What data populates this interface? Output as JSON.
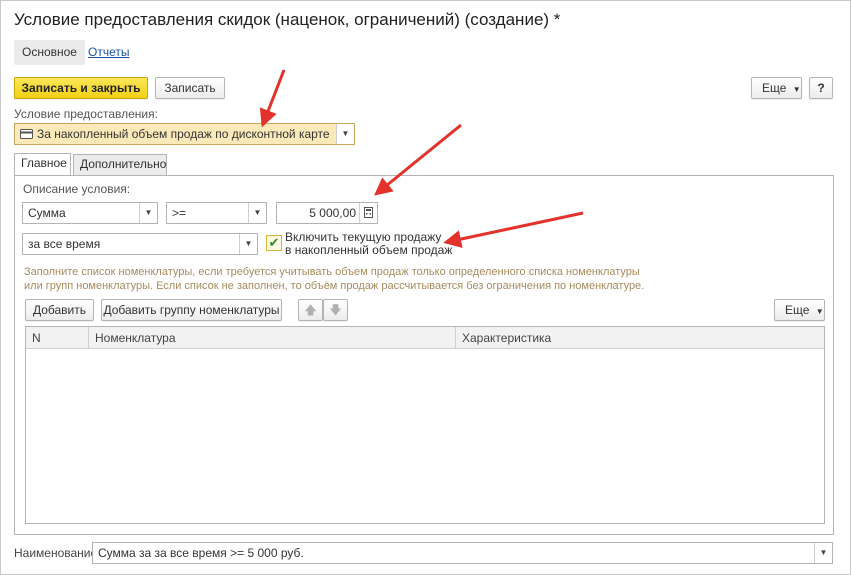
{
  "window": {
    "title": "Условие предоставления скидок (наценок, ограничений) (создание) *"
  },
  "nav": {
    "main": "Основное",
    "reports": "Отчеты"
  },
  "toolbar": {
    "save_close": "Записать и закрыть",
    "save": "Записать",
    "more": "Еще",
    "help": "?"
  },
  "condition": {
    "label": "Условие предоставления:",
    "value": "За накопленный объем продаж по дисконтной карте"
  },
  "tabs": {
    "main": "Главное",
    "extra": "Дополнительно"
  },
  "description": {
    "label": "Описание условия:",
    "type_value": "Сумма",
    "operator_value": ">=",
    "amount_value": "5 000,00",
    "period_value": "за все время",
    "include_current_line1": "Включить текущую продажу",
    "include_current_line2": "в накопленный объем продаж",
    "include_current_checked": true
  },
  "hint": {
    "line1": "Заполните список номенклатуры, если требуется учитывать объем продаж только определенного списка номенклатуры",
    "line2": "или групп номенклатуры. Если список не заполнен, то объём продаж рассчитывается без ограничения по номенклатуре."
  },
  "list_toolbar": {
    "add": "Добавить",
    "add_group": "Добавить группу номенклатуры",
    "more": "Еще"
  },
  "table": {
    "columns": [
      "N",
      "Номенклатура",
      "Характеристика"
    ],
    "rows": []
  },
  "footer": {
    "name_label": "Наименование:",
    "name_value": "Сумма за за все время  >= 5 000 руб."
  },
  "colors": {
    "primary_button": "#f5d728",
    "annotation_arrow": "#e3322b",
    "hint_text": "#a48c5e",
    "link": "#1a53a8"
  }
}
